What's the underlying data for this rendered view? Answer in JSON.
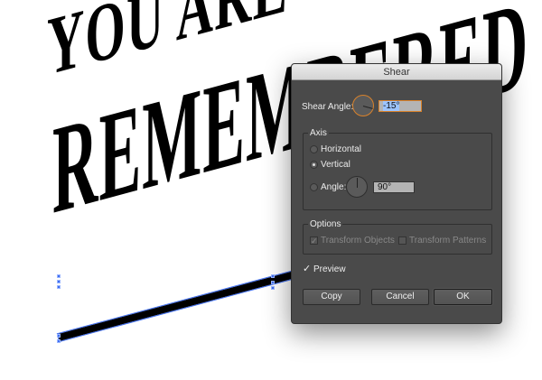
{
  "artwork": {
    "line1": "YOU ARE",
    "line2": "REMEMBERED"
  },
  "dialog": {
    "title": "Shear",
    "shear_angle_label": "Shear Angle:",
    "shear_angle_value": "-15°",
    "axis_label": "Axis",
    "horizontal_label": "Horizontal",
    "vertical_label": "Vertical",
    "angle_label": "Angle:",
    "angle_value": "90°",
    "selected_axis": "Vertical",
    "options_label": "Options",
    "transform_objects_label": "Transform Objects",
    "transform_objects_checked": true,
    "transform_patterns_label": "Transform Patterns",
    "transform_patterns_checked": false,
    "preview_label": "Preview",
    "preview_checked": true,
    "copy_label": "Copy",
    "cancel_label": "Cancel",
    "ok_label": "OK",
    "accent": "#d9822b"
  }
}
